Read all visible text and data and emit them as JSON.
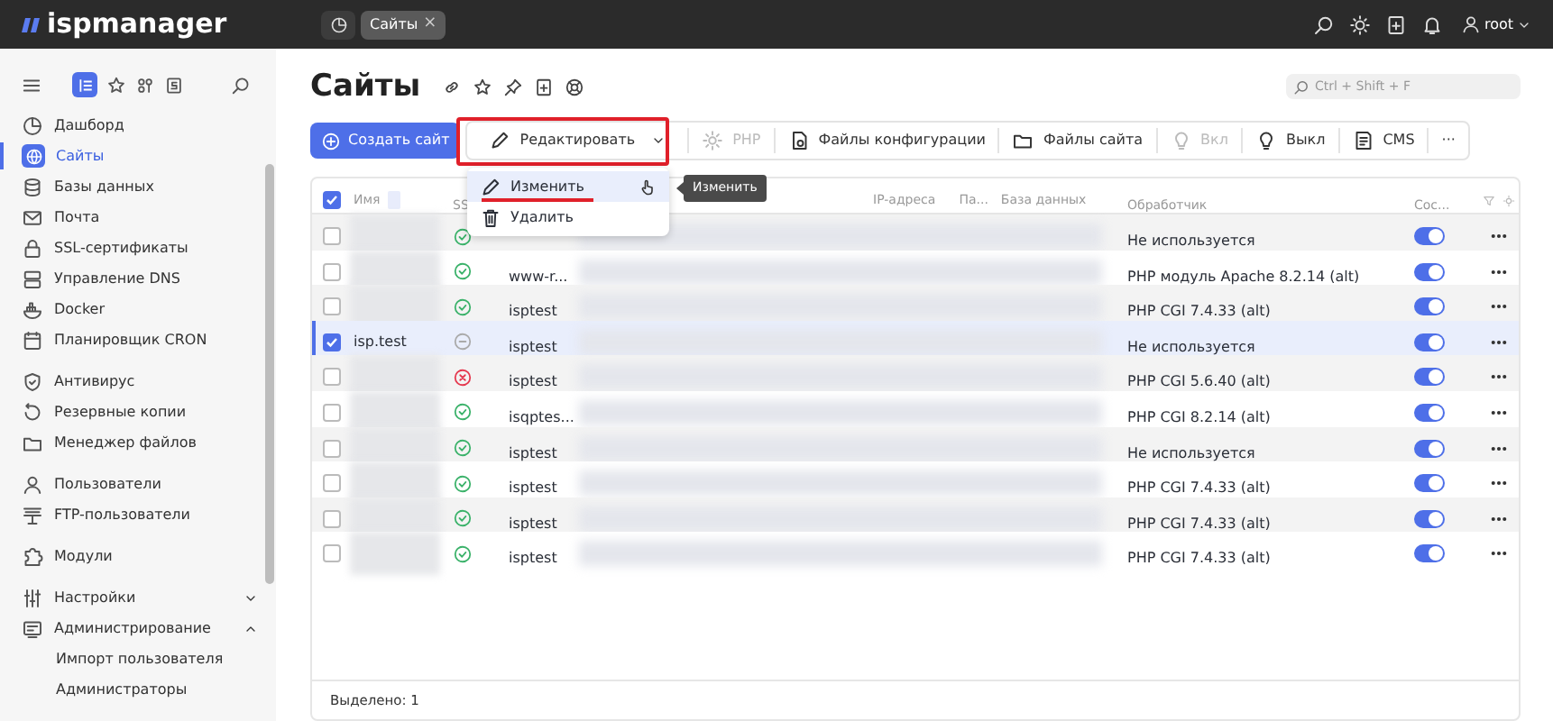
{
  "topbar": {
    "logo": "ispmanager",
    "tabs": [
      {
        "label": "Сайты",
        "close": "×"
      }
    ],
    "user": "root"
  },
  "sidebar": {
    "items": [
      {
        "label": "Дашборд",
        "selected": false
      },
      {
        "label": "Сайты",
        "selected": true
      },
      {
        "label": "Базы данных",
        "selected": false
      },
      {
        "label": "Почта",
        "selected": false
      },
      {
        "label": "SSL-сертификаты",
        "selected": false
      },
      {
        "label": "Управление DNS",
        "selected": false
      },
      {
        "label": "Docker",
        "selected": false
      },
      {
        "label": "Планировщик CRON",
        "selected": false
      },
      {
        "label": "Антивирус",
        "selected": false,
        "group_start": true
      },
      {
        "label": "Резервные копии",
        "selected": false
      },
      {
        "label": "Менеджер файлов",
        "selected": false
      },
      {
        "label": "Пользователи",
        "selected": false,
        "group_start": true
      },
      {
        "label": "FTP-пользователи",
        "selected": false
      },
      {
        "label": "Модули",
        "selected": false,
        "group_start": true
      },
      {
        "label": "Настройки",
        "selected": false,
        "group_start": true,
        "expanded": false
      },
      {
        "label": "Администрирование",
        "selected": false,
        "expanded": true,
        "children": [
          {
            "label": "Импорт пользователя",
            "selected": false
          },
          {
            "label": "Администраторы",
            "selected": false
          }
        ]
      }
    ]
  },
  "page": {
    "title": "Сайты",
    "search": {
      "placeholder": "Ctrl + Shift + F"
    }
  },
  "toolbar": {
    "create": "Создать сайт",
    "buttons": [
      {
        "label": "Редактировать",
        "disabled": false,
        "dropdown": true
      },
      {
        "label": "PHP",
        "disabled": true
      },
      {
        "label": "Файлы конфигурации",
        "disabled": false
      },
      {
        "label": "Файлы сайта",
        "disabled": false
      },
      {
        "label": "Вкл",
        "disabled": true
      },
      {
        "label": "Выкл",
        "disabled": false
      },
      {
        "label": "CMS",
        "disabled": false
      },
      {
        "label": "···",
        "disabled": false
      }
    ]
  },
  "menu": {
    "items": [
      {
        "label": "Изменить",
        "selected": true
      },
      {
        "label": "Удалить",
        "selected": false
      }
    ],
    "tooltip": "Изменить"
  },
  "table": {
    "columns": [
      "Имя",
      "SS",
      "IP-адреса",
      "Па...",
      "База данных",
      "Обработчик",
      "Сос..."
    ],
    "all_checked": true,
    "rows": [
      {
        "selected": false,
        "ssl": {
          "kind": "ok"
        },
        "handler": "Не используется",
        "on": true
      },
      {
        "selected": false,
        "ssl": {
          "kind": "ok"
        },
        "alias": "www-r...",
        "handler": "PHP модуль Apache 8.2.14 (alt)",
        "on": true
      },
      {
        "selected": false,
        "ssl": {
          "kind": "ok"
        },
        "alias": "isptest",
        "handler": "PHP CGI 7.4.33 (alt)",
        "on": true
      },
      {
        "selected": true,
        "name": "isp.test",
        "ssl": {
          "kind": "none"
        },
        "alias": "isptest",
        "handler": "Не используется",
        "on": true
      },
      {
        "selected": false,
        "ssl": {
          "kind": "error"
        },
        "alias": "isptest",
        "handler": "PHP CGI 5.6.40 (alt)",
        "on": true
      },
      {
        "selected": false,
        "ssl": {
          "kind": "ok"
        },
        "alias": "isqptes...",
        "handler": "PHP CGI 8.2.14 (alt)",
        "on": true
      },
      {
        "selected": false,
        "ssl": {
          "kind": "ok"
        },
        "alias": "isptest",
        "handler": "Не используется",
        "on": true
      },
      {
        "selected": false,
        "ssl": {
          "kind": "ok"
        },
        "alias": "isptest",
        "handler": "PHP CGI 7.4.33 (alt)",
        "on": true
      },
      {
        "selected": false,
        "ssl": {
          "kind": "ok"
        },
        "alias": "isptest",
        "handler": "PHP CGI 7.4.33 (alt)",
        "on": true
      },
      {
        "selected": false,
        "ssl": {
          "kind": "ok"
        },
        "alias": "isptest",
        "handler": "PHP CGI 7.4.33 (alt)",
        "on": true
      }
    ],
    "footer": "Выделено: 1"
  }
}
